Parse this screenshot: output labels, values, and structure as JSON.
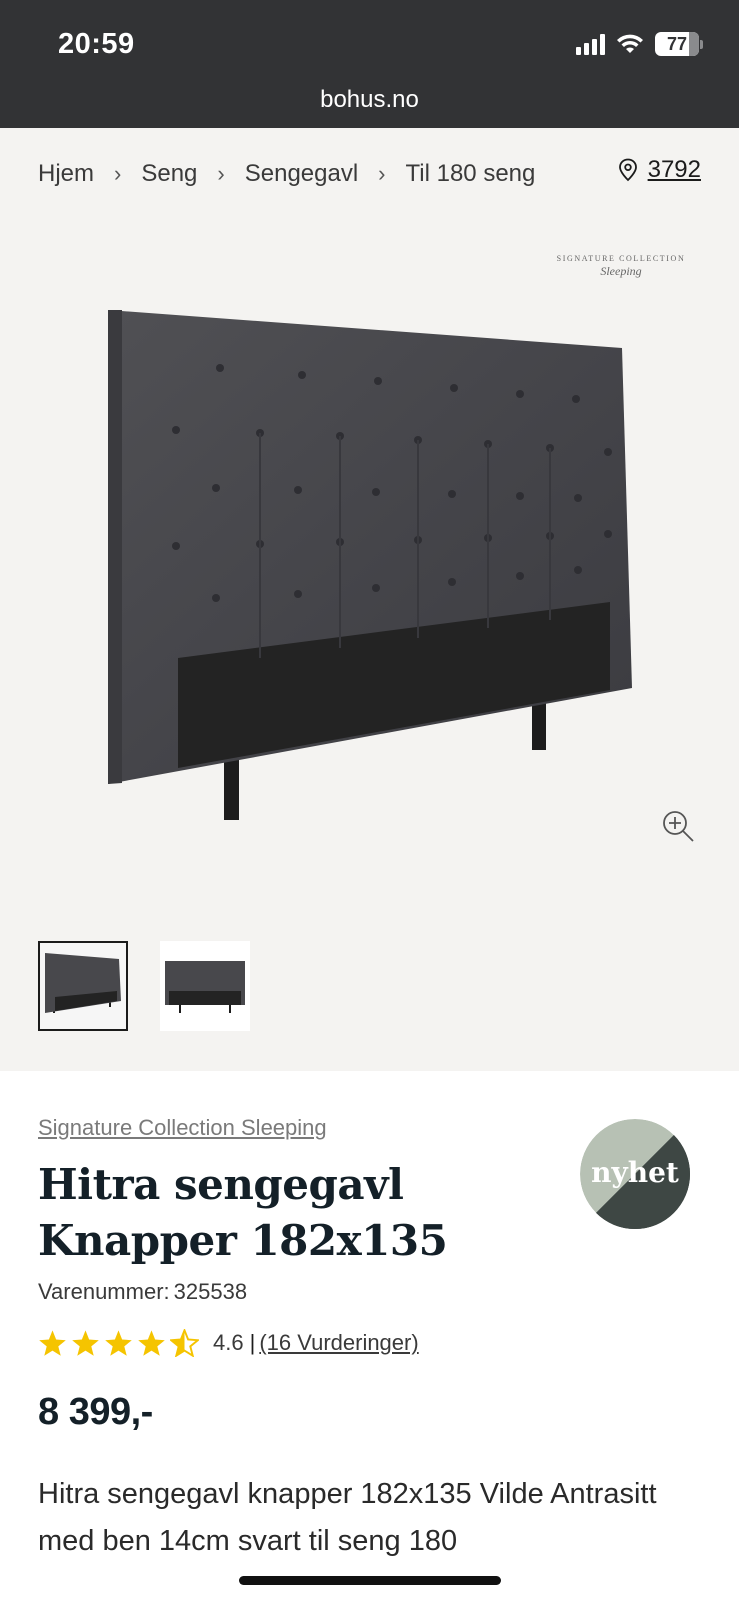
{
  "status": {
    "time": "20:59",
    "battery": "77"
  },
  "browser": {
    "url": "bohus.no"
  },
  "breadcrumb": [
    "Hjem",
    "Seng",
    "Sengegavl",
    "Til 180 seng"
  ],
  "store": {
    "number": "3792"
  },
  "brand_logo": {
    "line1": "SIGNATURE COLLECTION",
    "line2": "Sleeping"
  },
  "product": {
    "brand": "Signature Collection Sleeping",
    "title": "Hitra sengegavl Knapper 182x135",
    "sku_label": "Varenummer:",
    "sku": "325538",
    "badge": "nyhet",
    "rating": {
      "value": "4.6",
      "separator": "|",
      "count_text": "(16 Vurderinger)",
      "stars": 4.5
    },
    "price": "8 399,-",
    "description": "Hitra sengegavl knapper 182x135 Vilde Antrasitt med ben 14cm svart til seng 180"
  },
  "colors": {
    "topbar": "#323335",
    "gallery_bg": "#f4f3f1",
    "star": "#f5c400",
    "title": "#142028",
    "badge_light": "#b7c1b4",
    "badge_dark": "#3e4744"
  },
  "icons": [
    "signal-icon",
    "wifi-icon",
    "battery-icon",
    "chevron-right-icon",
    "location-pin-icon",
    "zoom-in-icon",
    "star-icon"
  ]
}
